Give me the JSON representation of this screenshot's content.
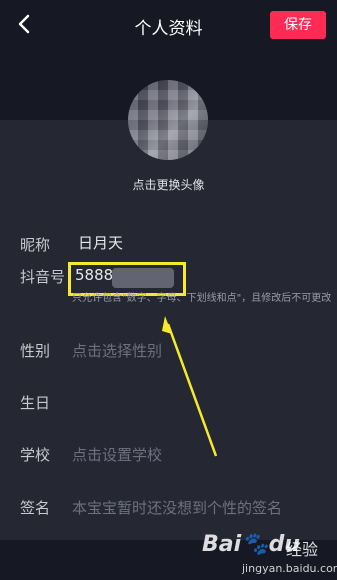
{
  "header": {
    "back_icon": "chevron-left-icon",
    "title": "个人资料",
    "save_label": "保存",
    "save_color": "#fe2c55"
  },
  "avatar": {
    "change_label": "点击更换头像"
  },
  "fields": {
    "nickname": {
      "label": "昵称",
      "value": "日月天"
    },
    "douyin_id": {
      "label": "抖音号",
      "value": "5888",
      "hint": "只允许包含\"数字、字母、下划线和点\"，且修改后不可更改"
    },
    "gender": {
      "label": "性别",
      "placeholder": "点击选择性别"
    },
    "birthday": {
      "label": "生日",
      "placeholder": ""
    },
    "school": {
      "label": "学校",
      "placeholder": "点击设置学校"
    },
    "signature": {
      "label": "签名",
      "placeholder": "本宝宝暂时还没想到个性的签名"
    }
  },
  "annotation": {
    "highlight_color": "#f6ea2a"
  },
  "watermark": {
    "brand": "Bai",
    "brand_suffix": "du",
    "text": "经验",
    "url": "jingyan.baidu.com"
  }
}
